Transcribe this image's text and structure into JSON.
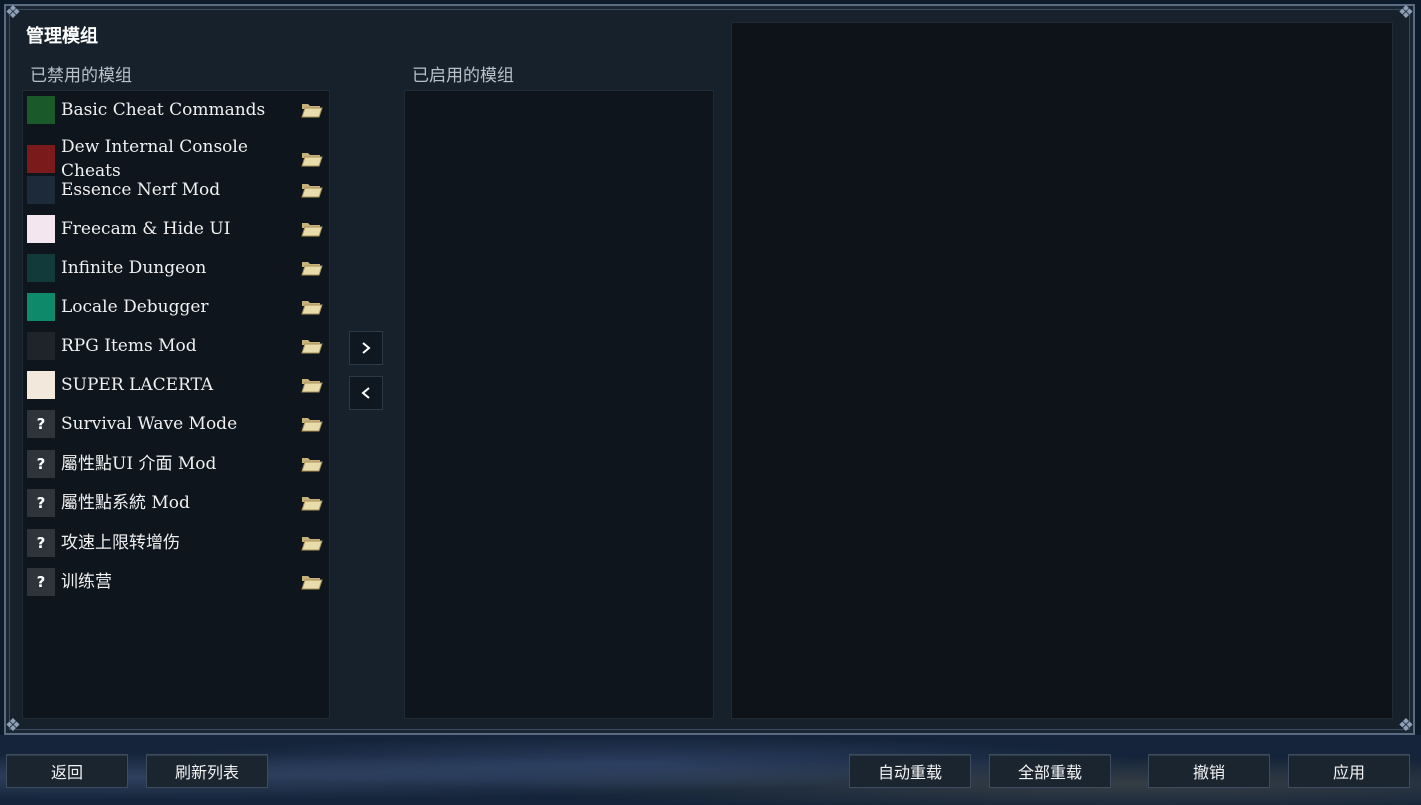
{
  "window": {
    "title": "管理模组"
  },
  "disabled_header": "已禁用的模组",
  "enabled_header": "已启用的模组",
  "disabled_mods": [
    {
      "name": "Basic Cheat Commands",
      "icon": "green-tree-icon",
      "icon_text": "",
      "icon_bg": "#1a5a2a",
      "icon_fg": "#7bff6a"
    },
    {
      "name": "Dew Internal Console Cheats",
      "icon": "red-figure-icon",
      "icon_text": "",
      "icon_bg": "#7a1a1a",
      "icon_fg": "#ff9a9a"
    },
    {
      "name": "Essence Nerf Mod",
      "icon": "diamond-icon",
      "icon_text": "",
      "icon_bg": "#1c2a3a",
      "icon_fg": "#6ab0ff"
    },
    {
      "name": "Freecam & Hide UI",
      "icon": "pink-sketch-icon",
      "icon_text": "",
      "icon_bg": "#f4e6ee",
      "icon_fg": "#c0306a"
    },
    {
      "name": "Infinite Dungeon",
      "icon": "dungeon-icon",
      "icon_text": "",
      "icon_bg": "#123a3a",
      "icon_fg": "#7ad0d0"
    },
    {
      "name": "Locale Debugger",
      "icon": "bug-icon",
      "icon_text": "",
      "icon_bg": "#0e8a6a",
      "icon_fg": "#ffffff"
    },
    {
      "name": "RPG Items Mod",
      "icon": "rpg-icon",
      "icon_text": "",
      "icon_bg": "#1e242a",
      "icon_fg": "#d8b84a"
    },
    {
      "name": "SUPER LACERTA",
      "icon": "lacerta-icon",
      "icon_text": "",
      "icon_bg": "#f2e8dc",
      "icon_fg": "#704020"
    },
    {
      "name": "Survival Wave Mode",
      "icon": "question-icon",
      "icon_text": "?",
      "icon_bg": "#2e343a",
      "icon_fg": "#ffffff"
    },
    {
      "name": "屬性點UI 介面 Mod",
      "icon": "question-icon",
      "icon_text": "?",
      "icon_bg": "#2e343a",
      "icon_fg": "#ffffff"
    },
    {
      "name": "屬性點系統 Mod",
      "icon": "question-icon",
      "icon_text": "?",
      "icon_bg": "#2e343a",
      "icon_fg": "#ffffff"
    },
    {
      "name": "攻速上限转增伤",
      "icon": "question-icon",
      "icon_text": "?",
      "icon_bg": "#2e343a",
      "icon_fg": "#ffffff"
    },
    {
      "name": "训练营",
      "icon": "question-icon",
      "icon_text": "?",
      "icon_bg": "#2e343a",
      "icon_fg": "#ffffff"
    }
  ],
  "enabled_mods": [],
  "controls": {
    "enable_icon": "chevron-right-icon",
    "disable_icon": "chevron-left-icon"
  },
  "buttons": {
    "back": "返回",
    "refresh": "刷新列表",
    "auto_reload": "自动重载",
    "reload_all": "全部重载",
    "undo": "撤销",
    "apply": "应用"
  }
}
